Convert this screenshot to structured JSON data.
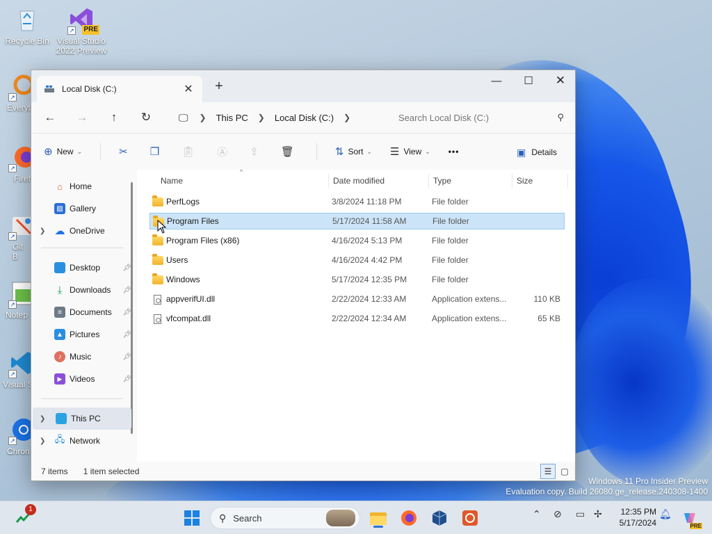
{
  "desktop": {
    "icons": [
      {
        "label": "Recycle Bin",
        "icon": "recycle-bin-icon"
      },
      {
        "label": "Visual Studio 2022 Preview",
        "icon": "visual-studio-icon",
        "badge": "PRE"
      },
      {
        "label": "Everyt",
        "icon": "everything-icon"
      },
      {
        "label": "Firef",
        "icon": "firefox-icon"
      },
      {
        "label": "Git B",
        "icon": "git-bash-icon"
      },
      {
        "label": "Notep",
        "icon": "notepad-icon"
      },
      {
        "label": "Visual S Cod",
        "icon": "vscode-icon"
      },
      {
        "label": "Chron",
        "icon": "chrome-icon"
      }
    ],
    "watermark_line1": "Windows 11 Pro Insider Preview",
    "watermark_line2": "Evaluation copy. Build 26080.ge_release.240308-1400"
  },
  "explorer": {
    "tab_title": "Local Disk (C:)",
    "new_tab": "+",
    "breadcrumb": [
      "This PC",
      "Local Disk (C:)"
    ],
    "search_placeholder": "Search Local Disk (C:)",
    "toolbar": {
      "new_label": "New",
      "sort_label": "Sort",
      "view_label": "View",
      "more_label": "•••",
      "details_label": "Details"
    },
    "nav": {
      "home": "Home",
      "gallery": "Gallery",
      "onedrive": "OneDrive",
      "desktop": "Desktop",
      "downloads": "Downloads",
      "documents": "Documents",
      "pictures": "Pictures",
      "music": "Music",
      "videos": "Videos",
      "this_pc": "This PC",
      "network": "Network"
    },
    "columns": {
      "name": "Name",
      "date": "Date modified",
      "type": "Type",
      "size": "Size"
    },
    "files": [
      {
        "name": "PerfLogs",
        "date": "3/8/2024 11:18 PM",
        "type": "File folder",
        "size": "",
        "kind": "folder"
      },
      {
        "name": "Program Files",
        "date": "5/17/2024 11:58 AM",
        "type": "File folder",
        "size": "",
        "kind": "folder",
        "selected": true
      },
      {
        "name": "Program Files (x86)",
        "date": "4/16/2024 5:13 PM",
        "type": "File folder",
        "size": "",
        "kind": "folder"
      },
      {
        "name": "Users",
        "date": "4/16/2024 4:42 PM",
        "type": "File folder",
        "size": "",
        "kind": "folder"
      },
      {
        "name": "Windows",
        "date": "5/17/2024 12:35 PM",
        "type": "File folder",
        "size": "",
        "kind": "folder"
      },
      {
        "name": "appverifUI.dll",
        "date": "2/22/2024 12:33 AM",
        "type": "Application extens...",
        "size": "110 KB",
        "kind": "dll"
      },
      {
        "name": "vfcompat.dll",
        "date": "2/22/2024 12:34 AM",
        "type": "Application extens...",
        "size": "65 KB",
        "kind": "dll"
      }
    ],
    "status": {
      "count": "7 items",
      "selected": "1 item selected"
    }
  },
  "taskbar": {
    "search_label": "Search",
    "notification_count": "1",
    "time": "12:35 PM",
    "date": "5/17/2024",
    "copilot_badge": "PRE"
  },
  "colors": {
    "accent": "#2b6fd6",
    "selection": "#cce4f7",
    "folder": "#f2b32c"
  }
}
